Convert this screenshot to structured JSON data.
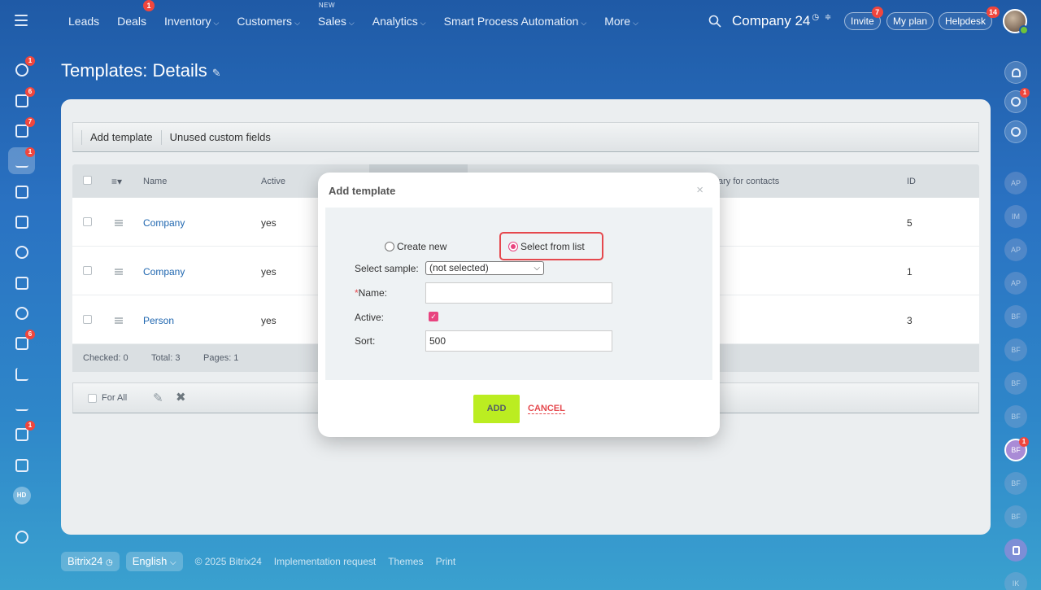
{
  "topbar": {
    "nav": [
      {
        "label": "Leads",
        "chevron": false
      },
      {
        "label": "Deals",
        "chevron": false,
        "badge": "1"
      },
      {
        "label": "Inventory",
        "chevron": true
      },
      {
        "label": "Customers",
        "chevron": true
      },
      {
        "label": "Sales",
        "chevron": true,
        "tag": "NEW"
      },
      {
        "label": "Analytics",
        "chevron": true
      },
      {
        "label": "Smart Process Automation",
        "chevron": true
      },
      {
        "label": "More",
        "chevron": true
      }
    ],
    "company": "Company 24",
    "invite": "Invite",
    "invite_badge": "7",
    "my_plan": "My plan",
    "helpdesk": "Helpdesk",
    "helpdesk_badge": "14"
  },
  "sidebar": {
    "badges": [
      "1",
      "6",
      "7",
      "1",
      "6",
      "1"
    ],
    "hd": "HD"
  },
  "rightbar": {
    "badge_top": "1",
    "avatars": [
      "AP",
      "IM",
      "AP",
      "AP",
      "BF",
      "BF",
      "BF",
      "BF",
      "BF",
      "BF",
      "BF",
      "IK"
    ],
    "active_badge": "1"
  },
  "page": {
    "title": "Templates: Details"
  },
  "toolbar": {
    "add_template": "Add template",
    "unused_fields": "Unused custom fields"
  },
  "grid": {
    "headers": {
      "name": "Name",
      "active": "Active",
      "primary": "ary for contacts",
      "id": "ID"
    },
    "rows": [
      {
        "name": "Company",
        "active": "yes",
        "id": "5"
      },
      {
        "name": "Company",
        "active": "yes",
        "id": "1"
      },
      {
        "name": "Person",
        "active": "yes",
        "id": "3"
      }
    ],
    "footer": {
      "checked": "Checked: 0",
      "total": "Total: 3",
      "pages": "Pages:  1"
    }
  },
  "actions": {
    "for_all": "For All"
  },
  "footer": {
    "brand": "Bitrix24",
    "language": "English",
    "copyright": "© 2025 Bitrix24",
    "implementation": "Implementation request",
    "themes": "Themes",
    "print": "Print"
  },
  "dialog": {
    "title": "Add template",
    "close": "×",
    "create_new": "Create new",
    "select_from_list": "Select from list",
    "select_sample_label": "Select sample:",
    "select_sample_value": "(not selected)",
    "name_label": "Name:",
    "name_value": "",
    "active_label": "Active:",
    "active_checked": true,
    "sort_label": "Sort:",
    "sort_value": "500",
    "add_button": "ADD",
    "cancel_button": "CANCEL"
  },
  "colors": {
    "accent_pink": "#e8447f",
    "add_green": "#bbed21",
    "highlight_red": "#e5484d",
    "badge_red": "#f0463d"
  }
}
